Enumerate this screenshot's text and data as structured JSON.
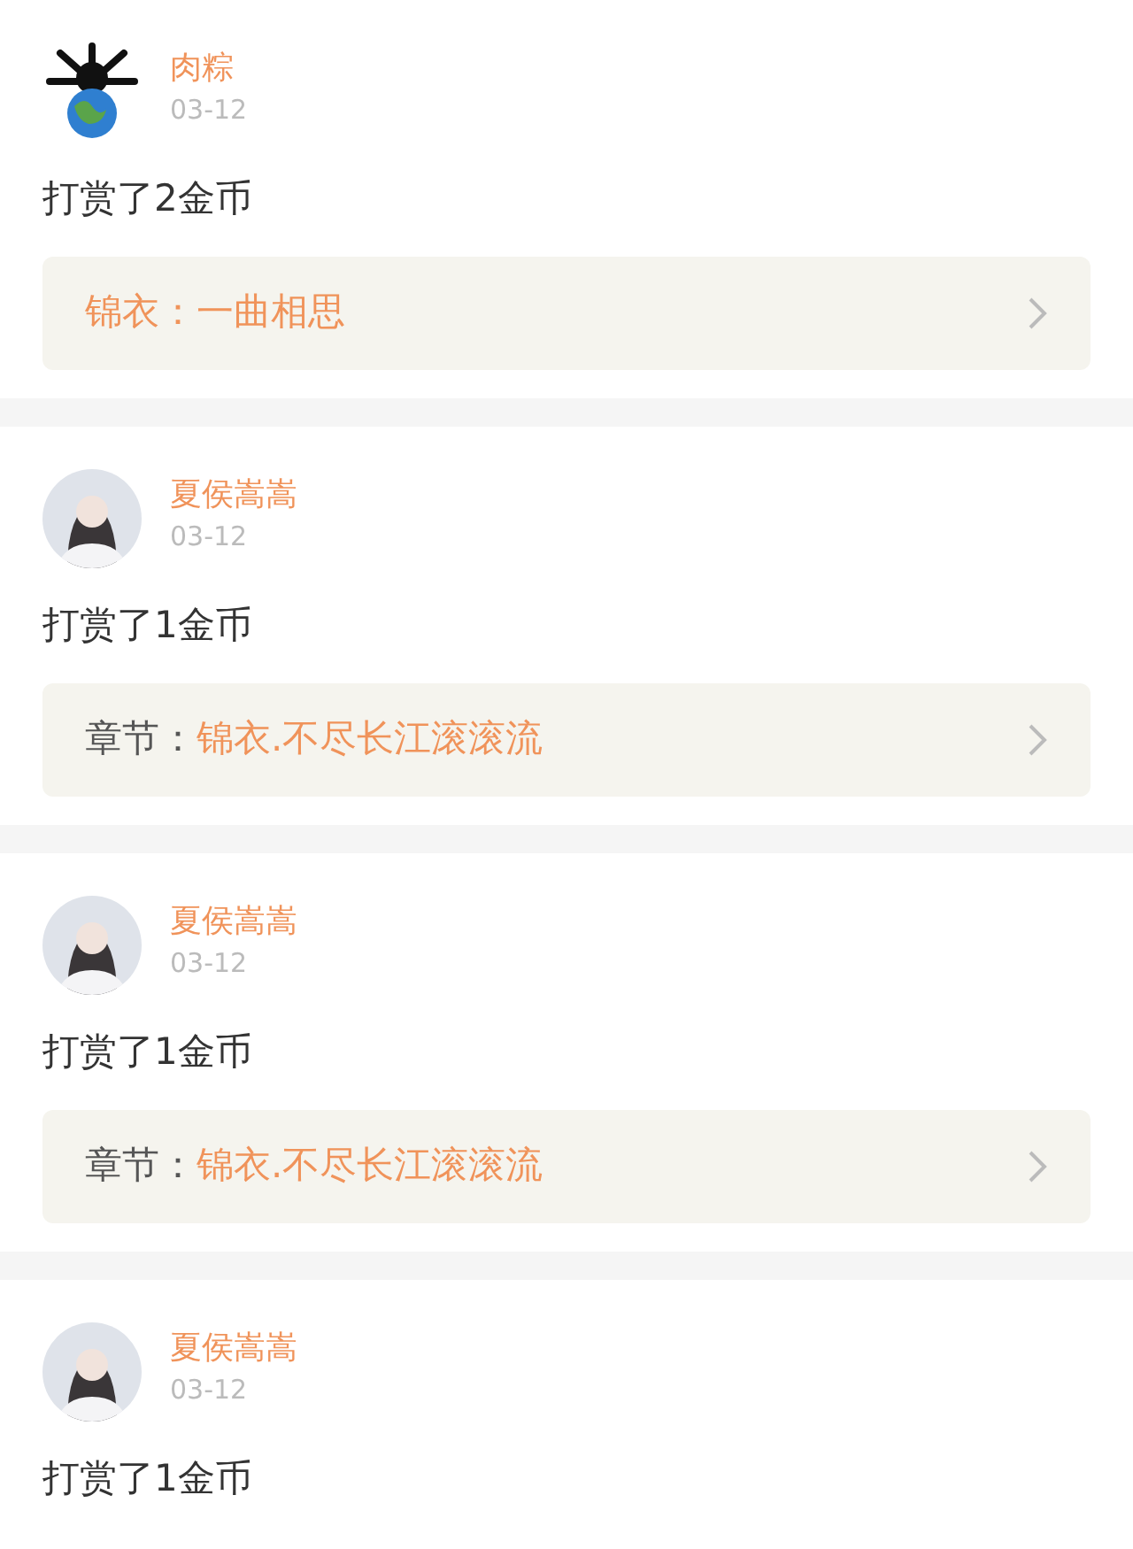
{
  "feed": [
    {
      "kind": "globe",
      "user": "肉粽",
      "date": "03-12",
      "action": "打赏了2金币",
      "link": {
        "title": "锦衣：一曲相思"
      }
    },
    {
      "kind": "person",
      "user": "夏侯嵩嵩",
      "date": "03-12",
      "action": "打赏了1金币",
      "link": {
        "label": "章节：",
        "title": "锦衣.不尽长江滚滚流"
      }
    },
    {
      "kind": "person",
      "user": "夏侯嵩嵩",
      "date": "03-12",
      "action": "打赏了1金币",
      "link": {
        "label": "章节：",
        "title": "锦衣.不尽长江滚滚流"
      }
    },
    {
      "kind": "person",
      "user": "夏侯嵩嵩",
      "date": "03-12",
      "action": "打赏了1金币"
    }
  ]
}
